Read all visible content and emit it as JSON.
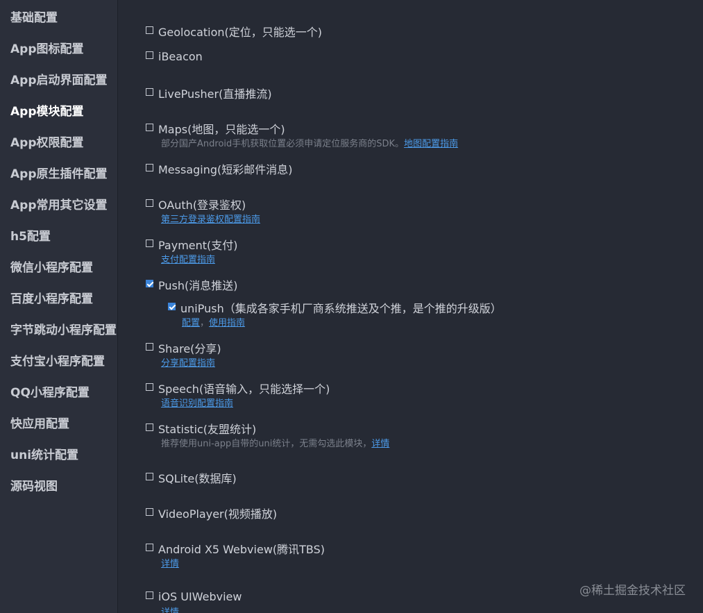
{
  "sidebar": {
    "items": [
      {
        "label": "基础配置"
      },
      {
        "label": "App图标配置"
      },
      {
        "label": "App启动界面配置"
      },
      {
        "label": "App模块配置"
      },
      {
        "label": "App权限配置"
      },
      {
        "label": "App原生插件配置"
      },
      {
        "label": "App常用其它设置"
      },
      {
        "label": "h5配置"
      },
      {
        "label": "微信小程序配置"
      },
      {
        "label": "百度小程序配置"
      },
      {
        "label": "字节跳动小程序配置"
      },
      {
        "label": "支付宝小程序配置"
      },
      {
        "label": "QQ小程序配置"
      },
      {
        "label": "快应用配置"
      },
      {
        "label": "uni统计配置"
      },
      {
        "label": "源码视图"
      }
    ],
    "active_index": 3
  },
  "modules": {
    "geolocation": {
      "label": "Geolocation(定位，只能选一个)",
      "checked": false
    },
    "ibeacon": {
      "label": "iBeacon",
      "checked": false
    },
    "livepusher": {
      "label": "LivePusher(直播推流)",
      "checked": false
    },
    "maps": {
      "label": "Maps(地图，只能选一个)",
      "checked": false,
      "note": "部分国产Android手机获取位置必须申请定位服务商的SDK。",
      "link": "地图配置指南"
    },
    "messaging": {
      "label": "Messaging(短彩邮件消息)",
      "checked": false
    },
    "oauth": {
      "label": "OAuth(登录鉴权)",
      "checked": false,
      "link": "第三方登录鉴权配置指南"
    },
    "payment": {
      "label": "Payment(支付)",
      "checked": false,
      "link": "支付配置指南"
    },
    "push": {
      "label": "Push(消息推送)",
      "checked": true
    },
    "unipush": {
      "label": "uniPush（集成各家手机厂商系统推送及个推，是个推的升级版）",
      "checked": true,
      "link_config": "配置",
      "separator": "，",
      "link_guide": "使用指南"
    },
    "share": {
      "label": "Share(分享)",
      "checked": false,
      "link": "分享配置指南"
    },
    "speech": {
      "label": "Speech(语音输入，只能选择一个)",
      "checked": false,
      "link": "语音识别配置指南"
    },
    "statistic": {
      "label": "Statistic(友盟统计)",
      "checked": false,
      "note": "推荐使用uni-app自带的uni统计，无需勾选此模块，",
      "link": "详情"
    },
    "sqlite": {
      "label": "SQLite(数据库)",
      "checked": false
    },
    "videoplayer": {
      "label": "VideoPlayer(视频播放)",
      "checked": false
    },
    "x5webview": {
      "label": "Android X5 Webview(腾讯TBS)",
      "checked": false,
      "link": "详情"
    },
    "uiwebview": {
      "label": "iOS UIWebview",
      "checked": false,
      "link": "详情"
    }
  },
  "watermark": "@稀土掘金技术社区"
}
